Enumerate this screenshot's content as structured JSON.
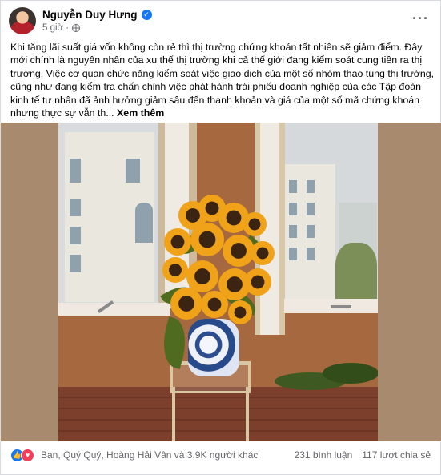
{
  "post": {
    "author": "Nguyễn Duy Hưng",
    "time": "5 giờ ·",
    "text": "Khi tăng lãi suất giá vốn không còn rẻ thì thị trường chứng khoán tất nhiên sẽ giảm điểm. Đây mới chính là nguyên nhân của xu thế thị trường khi cả thế giới đang kiểm soát cung tiền ra thị trường. Việc cơ quan chức năng kiểm soát việc giao dịch của một số nhóm thao túng thị trường, cũng như đang kiểm tra chấn chỉnh việc phát hành trái phiếu doanh nghiệp của các Tập đoàn kinh tế tư nhân đã ảnh hưởng giảm sâu đến thanh khoản và giá của một số mã chứng khoán nhưng thực sự vẫn th...",
    "see_more": "Xem thêm"
  },
  "icons": {
    "verified": "verified-badge-icon",
    "privacy": "globe-icon",
    "options": "more-options-icon",
    "like": "like-reaction-icon",
    "love": "love-reaction-icon"
  },
  "engagement": {
    "reactors": "Bạn, Quý Quý, Hoàng Hải Vân và 3,9K người khác",
    "comments": "231 bình luận",
    "shares": "117 lượt chia sẻ"
  },
  "colors": {
    "brand_blue": "#1877f2",
    "love_red": "#f33e58",
    "secondary_text": "#65676b"
  }
}
